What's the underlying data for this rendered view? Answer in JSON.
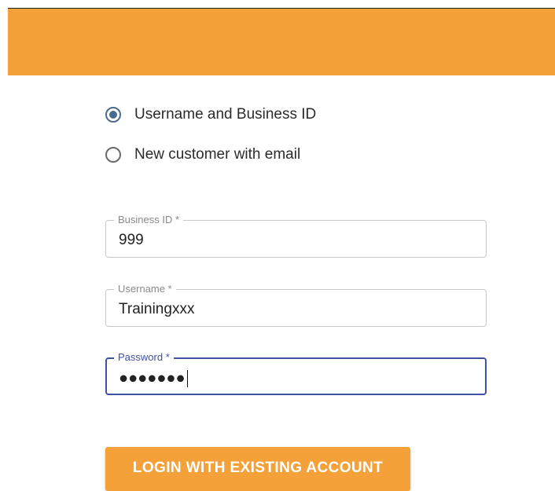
{
  "header": {
    "color": "#f5a13a"
  },
  "login_options": [
    {
      "label": "Username and Business ID",
      "selected": true
    },
    {
      "label": "New customer with email",
      "selected": false
    }
  ],
  "form": {
    "business_id": {
      "label": "Business ID *",
      "value": "999"
    },
    "username": {
      "label": "Username *",
      "value": "Trainingxxx"
    },
    "password": {
      "label": "Password *",
      "value": "●●●●●●●",
      "focused": true
    }
  },
  "actions": {
    "login_label": "LOGIN WITH EXISTING ACCOUNT"
  },
  "colors": {
    "accent": "#f5a13a",
    "focus": "#3f51a5",
    "radio": "#4a6d8f"
  }
}
